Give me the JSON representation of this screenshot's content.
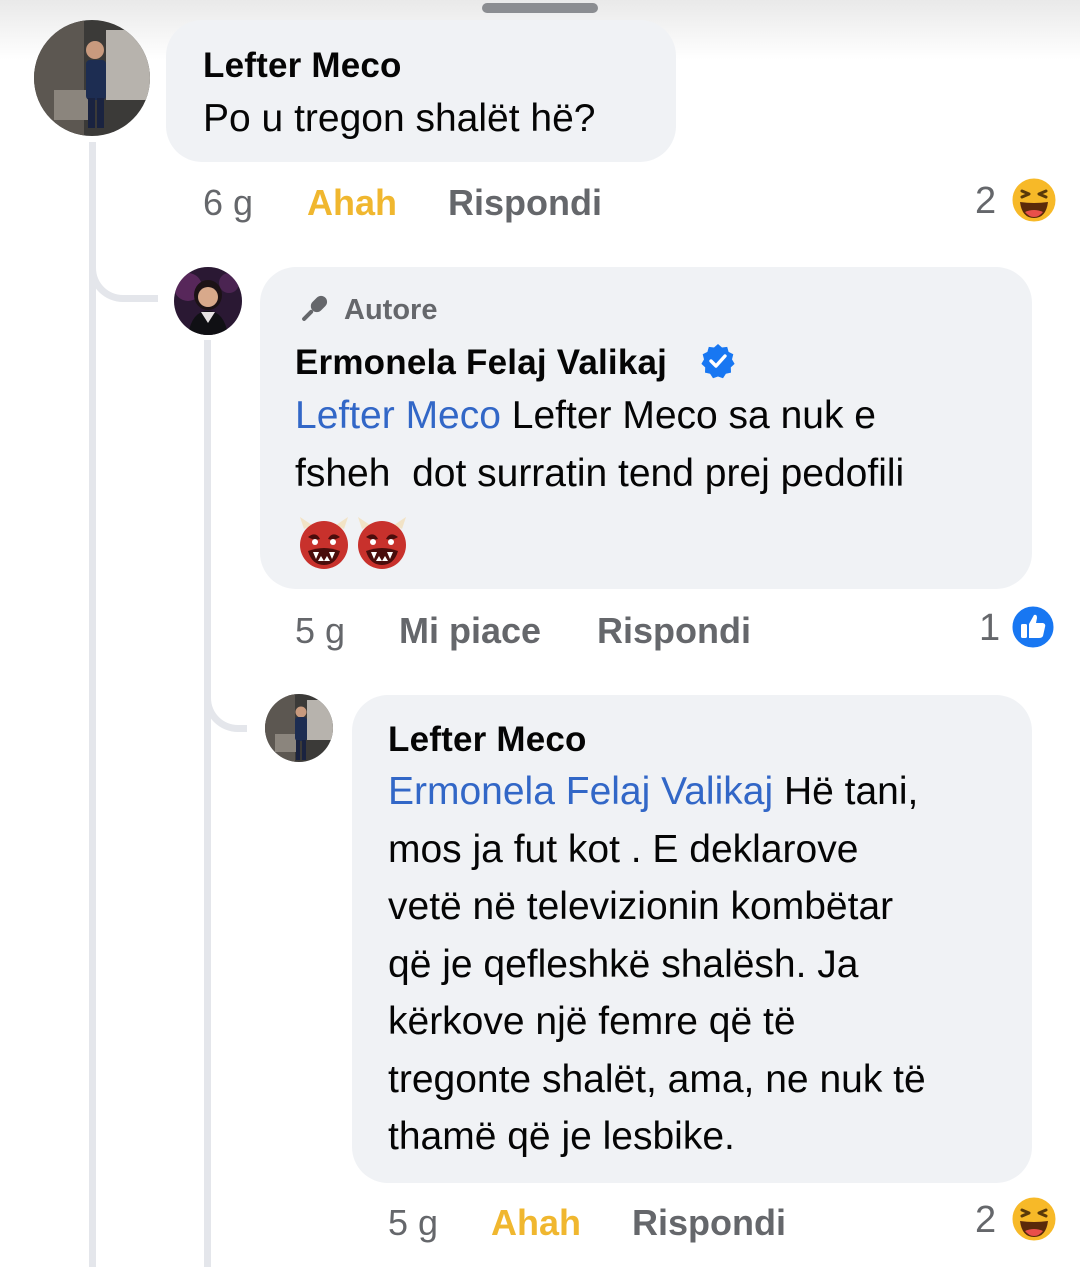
{
  "comments": [
    {
      "author": "Lefter Meco",
      "text": "Po u tregon shalët hë?",
      "time": "6 g",
      "reaction_label": "Ahah",
      "reply_label": "Rispondi",
      "reaction_count": "2",
      "reaction_icon": "haha-emoji-icon"
    },
    {
      "badge": "Autore",
      "badge_icon": "microphone-icon",
      "author": "Ermonela Felaj Valikaj",
      "verified_icon": "verified-badge-icon",
      "mention": "Lefter Meco",
      "line1": " Lefter Meco sa nuk e",
      "line2": "fsheh  dot surratin tend prej pedofili",
      "emojis": [
        "👹",
        "👹"
      ],
      "time": "5 g",
      "reaction_label": "Mi piace",
      "reply_label": "Rispondi",
      "reaction_count": "1",
      "reaction_icon": "like-thumb-icon"
    },
    {
      "author": "Lefter Meco",
      "mention": "Ermonela Felaj Valikaj",
      "line1": " Hë tani,",
      "line2": "mos ja fut kot . E deklarove",
      "line3": "vetë në televizionin kombëtar",
      "line4": "që je qefleshkë shalësh. Ja",
      "line5": "kërkove një femre që të",
      "line6": "tregonte shalët, ama, ne nuk të",
      "line7": "thamë që je lesbike.",
      "time": "5 g",
      "reaction_label": "Ahah",
      "reply_label": "Rispondi",
      "reaction_count": "2",
      "reaction_icon": "haha-emoji-icon"
    }
  ],
  "colors": {
    "bubble": "#f0f2f5",
    "mention": "#3267c7",
    "meta": "#65676b",
    "haha": "#f0b72f",
    "like": "#1877f2"
  }
}
